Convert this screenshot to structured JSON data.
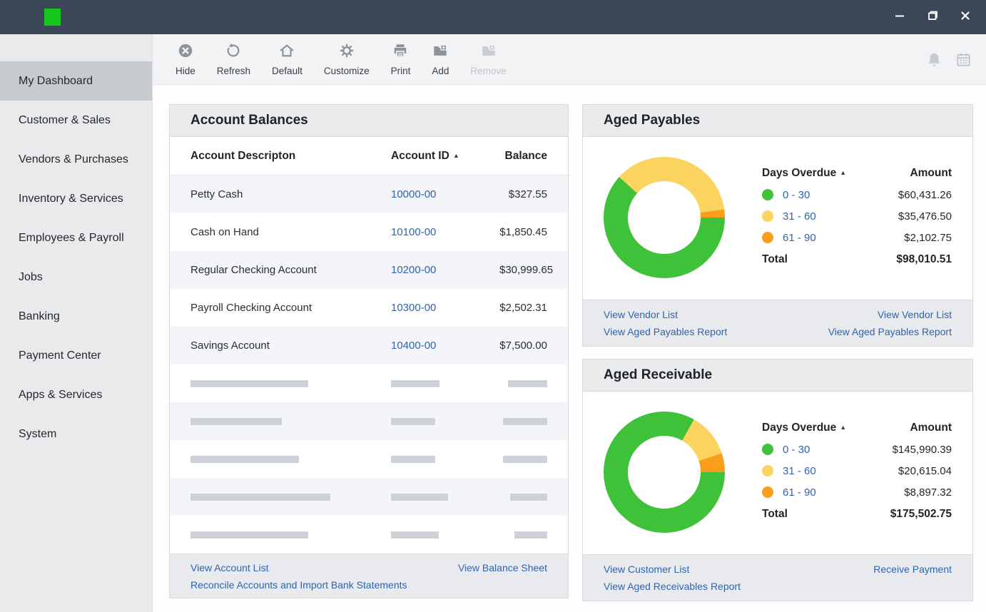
{
  "colors": {
    "link": "#3064ae",
    "green": "#3fc23a",
    "yellow": "#fad45f",
    "orange": "#f89e1b",
    "logo_green": "#15c61c"
  },
  "window": {
    "controls": [
      "minimize",
      "maximize",
      "close"
    ]
  },
  "toolbar": {
    "buttons": [
      {
        "label": "Hide",
        "icon": "hide-circle",
        "enabled": true
      },
      {
        "label": "Refresh",
        "icon": "refresh",
        "enabled": true
      },
      {
        "label": "Default",
        "icon": "home",
        "enabled": true
      },
      {
        "label": "Customize",
        "icon": "gear",
        "enabled": true
      },
      {
        "label": "Print",
        "icon": "printer",
        "enabled": true
      },
      {
        "label": "Add",
        "icon": "folder-add",
        "enabled": true
      },
      {
        "label": "Remove",
        "icon": "folder-remove",
        "enabled": false
      }
    ],
    "right_icons": [
      "bell",
      "calendar"
    ]
  },
  "sidebar": {
    "items": [
      {
        "label": "My Dashboard",
        "active": true
      },
      {
        "label": "Customer & Sales",
        "active": false
      },
      {
        "label": "Vendors & Purchases",
        "active": false
      },
      {
        "label": "Inventory & Services",
        "active": false
      },
      {
        "label": "Employees & Payroll",
        "active": false
      },
      {
        "label": "Jobs",
        "active": false
      },
      {
        "label": "Banking",
        "active": false
      },
      {
        "label": "Payment Center",
        "active": false
      },
      {
        "label": "Apps & Services",
        "active": false
      },
      {
        "label": "System",
        "active": false
      }
    ]
  },
  "account_balances": {
    "title": "Account Balances",
    "columns": {
      "description": "Account Descripton",
      "id": "Account ID",
      "balance": "Balance"
    },
    "sort_arrow": "▲",
    "rows": [
      {
        "description": "Petty Cash",
        "id": "10000-00",
        "balance": "$327.55"
      },
      {
        "description": "Cash on Hand",
        "id": "10100-00",
        "balance": "$1,850.45"
      },
      {
        "description": "Regular Checking Account",
        "id": "10200-00",
        "balance": "$30,999.65"
      },
      {
        "description": "Payroll Checking Account",
        "id": "10300-00",
        "balance": "$2,502.31"
      },
      {
        "description": "Savings Account",
        "id": "10400-00",
        "balance": "$7,500.00"
      }
    ],
    "placeholder_rows": [
      {
        "bars": [
          165,
          68,
          55
        ]
      },
      {
        "bars": [
          128,
          62,
          62
        ]
      },
      {
        "bars": [
          152,
          62,
          62
        ]
      },
      {
        "bars": [
          196,
          80,
          52
        ]
      },
      {
        "bars": [
          165,
          67,
          46
        ]
      }
    ],
    "footer": {
      "left": [
        "View Account List",
        "Reconcile Accounts and Import Bank Statements"
      ],
      "right": [
        "View Balance Sheet"
      ]
    }
  },
  "aged_payables": {
    "title": "Aged Payables",
    "legend": {
      "header_range": "Days Overdue",
      "header_amount": "Amount",
      "sort_arrow": "▲",
      "rows": [
        {
          "range": "0 - 30",
          "amount": "$60,431.26",
          "color": "#3fc23a"
        },
        {
          "range": "31 - 60",
          "amount": "$35,476.50",
          "color": "#fad45f"
        },
        {
          "range": "61 - 90",
          "amount": "$2,102.75",
          "color": "#f89e1b"
        }
      ],
      "total_label": "Total",
      "total_amount": "$98,010.51"
    },
    "footer": {
      "left": [
        "View Vendor List",
        "View Aged Payables Report"
      ],
      "right": [
        "View Vendor List",
        "View Aged Payables Report"
      ]
    }
  },
  "aged_receivable": {
    "title": "Aged Receivable",
    "legend": {
      "header_range": "Days Overdue",
      "header_amount": "Amount",
      "sort_arrow": "▲",
      "rows": [
        {
          "range": "0 - 30",
          "amount": "$145,990.39",
          "color": "#3fc23a"
        },
        {
          "range": "31 - 60",
          "amount": "$20,615.04",
          "color": "#fad45f"
        },
        {
          "range": "61 - 90",
          "amount": "$8,897.32",
          "color": "#f89e1b"
        }
      ],
      "total_label": "Total",
      "total_amount": "$175,502.75"
    },
    "footer": {
      "left": [
        "View Customer List",
        "View Aged Receivables Report"
      ],
      "right": [
        "Receive Payment"
      ]
    }
  },
  "chart_data": [
    {
      "type": "pie",
      "subtype": "donut",
      "title": "Aged Payables",
      "categories": [
        "0 - 30",
        "31 - 60",
        "61 - 90"
      ],
      "values": [
        60431.26,
        35476.5,
        2102.75
      ],
      "total": 98010.51,
      "colors": [
        "#3fc23a",
        "#fad45f",
        "#f89e1b"
      ],
      "start_angle_deg": 90,
      "direction": "clockwise",
      "legend_position": "right"
    },
    {
      "type": "pie",
      "subtype": "donut",
      "title": "Aged Receivable",
      "categories": [
        "0 - 30",
        "31 - 60",
        "61 - 90"
      ],
      "values": [
        145990.39,
        20615.04,
        8897.32
      ],
      "total": 175502.75,
      "colors": [
        "#3fc23a",
        "#fad45f",
        "#f89e1b"
      ],
      "start_angle_deg": 90,
      "direction": "clockwise",
      "legend_position": "right"
    }
  ]
}
